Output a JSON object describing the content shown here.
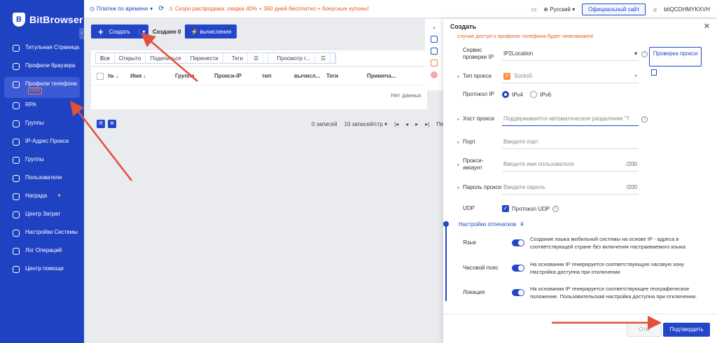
{
  "app": {
    "name": "BitBrowser"
  },
  "sidebar": {
    "items": [
      {
        "label": "Титульная Страница"
      },
      {
        "label": "Профили браузера"
      },
      {
        "label": "Профили телефона",
        "badge": "NEW"
      },
      {
        "label": "RPA"
      },
      {
        "label": "Группы"
      },
      {
        "label": "IP-Адрес Прокси"
      },
      {
        "label": "Группы"
      },
      {
        "label": "Пользователи"
      },
      {
        "label": "Награда"
      },
      {
        "label": "Центр Затрат"
      },
      {
        "label": "Настройки Системы"
      },
      {
        "label": "Лог Операций"
      },
      {
        "label": "Центр помощи"
      }
    ]
  },
  "topbar": {
    "payment": "Платеж по времени",
    "promo": "Скоро распродажа: скидка 40% + 360 дней бесплатно + бонусные купоны!",
    "language": "Русский",
    "official_site": "Официальный сайт",
    "username": "bitQCDHMYKXVH"
  },
  "toolbar": {
    "create": "Создать",
    "created": "Создано 0",
    "calc": "вычисления"
  },
  "filters": [
    "Все",
    "Открыто",
    "Поделиться",
    "Перенести",
    "Теги",
    "Просмотр г..."
  ],
  "table": {
    "columns": [
      "№",
      "Имя",
      "Группа",
      "Прокси-IP",
      "тип",
      "вычисл...",
      "Теги",
      "Примеча..."
    ],
    "empty": "Нет данных"
  },
  "pager": {
    "total": "0 записей",
    "per_page": "10 записей/стр",
    "goto": "Перей"
  },
  "drawer": {
    "title": "Создать",
    "warning": "случае доступ к профилю телефона будет невозможен!",
    "ip_service_label": "Сервис проверки IP",
    "ip_service_value": "IP2Location",
    "check_proxy": "Проверка прокси",
    "proxy_type_label": "Тип прокси",
    "proxy_type_value": "Socks5",
    "ip_protocol_label": "Протокол IP",
    "ipv4": "IPv4",
    "ipv6": "IPv6",
    "host_label": "Хост прокси",
    "host_placeholder": "Поддерживается автоматическое разделение \"Тиг",
    "port_label": "Порт",
    "port_placeholder": "Введите порт",
    "account_label": "Прокси-аккаунт",
    "account_placeholder": "Введите имя пользователя",
    "account_suffix": "/200",
    "password_label": "Пароль прокси",
    "password_placeholder": "Введите пароль",
    "password_suffix": "/200",
    "udp_label": "UDP",
    "udp_option": "Протокол UDP",
    "fingerprint_title": "Настройки отпечатков",
    "language_label": "Язык",
    "language_desc": "Создание языка мобильной системы на основе IP - адреса в соответствующей стране без включения настраиваемого языка",
    "timezone_label": "Часовой пояс",
    "timezone_desc": "На основании IP генерируется соответствующую часовую зону. Настройка доступна при отключении",
    "location_label": "Локация",
    "location_desc": "На основании IP генерируется соответствующее географическое положение. Пользовательская настройка доступна при отключении.",
    "cancel": "Отм",
    "confirm": "Подтвердить"
  },
  "colors": {
    "primary": "#2346c8",
    "sidebar": "#1f42c2",
    "warning": "#e65a20",
    "arrow": "#e0503a"
  }
}
